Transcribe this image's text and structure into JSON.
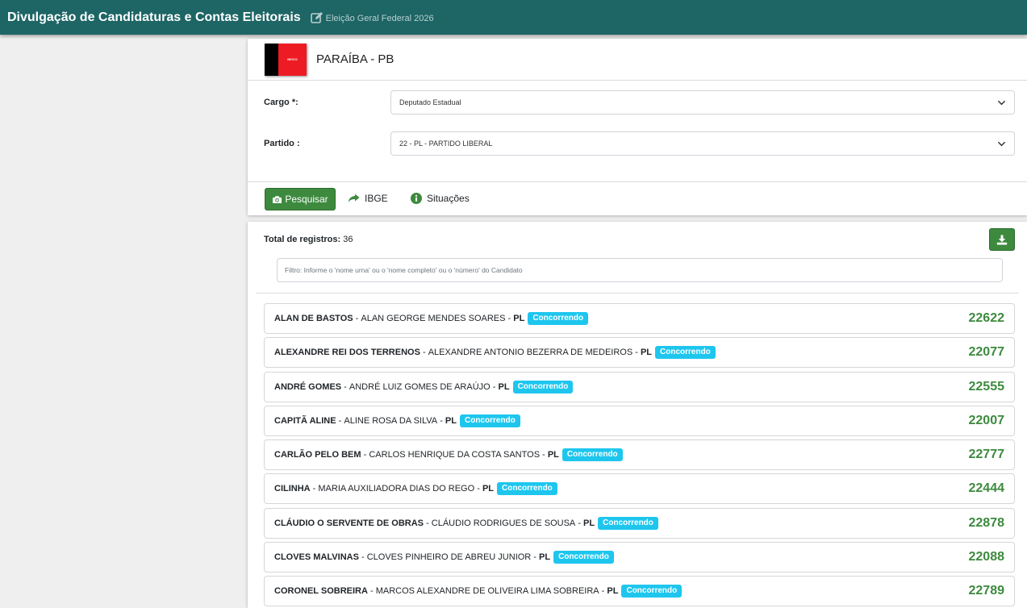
{
  "header": {
    "title": "Divulgação de Candidaturas e Contas Eleitorais",
    "subtitle": "Eleição Geral Federal 2026"
  },
  "uf": {
    "name": "PARAÍBA - PB",
    "flag_text": "NEGO"
  },
  "form": {
    "cargo_label": "Cargo *:",
    "cargo_value": "Deputado Estadual",
    "partido_label": "Partido :",
    "partido_value": "22 - PL - PARTIDO LIBERAL"
  },
  "actions": {
    "search_label": "Pesquisar",
    "ibge_label": "IBGE",
    "situacoes_label": "Situações"
  },
  "results": {
    "total_label": "Total de registros:",
    "total_value": "36",
    "filter_placeholder": "Filtro: Informe o 'nome urna' ou o 'nome completo' ou o 'número' do Candidato",
    "candidates": [
      {
        "urna": "ALAN DE BASTOS",
        "full": "ALAN GEORGE MENDES SOARES",
        "party": "PL",
        "status": "Concorrendo",
        "number": "22622"
      },
      {
        "urna": "ALEXANDRE REI DOS TERRENOS",
        "full": "ALEXANDRE ANTONIO BEZERRA DE MEDEIROS",
        "party": "PL",
        "status": "Concorrendo",
        "number": "22077"
      },
      {
        "urna": "ANDRÉ GOMES",
        "full": "ANDRÉ LUIZ GOMES DE ARAÚJO",
        "party": "PL",
        "status": "Concorrendo",
        "number": "22555"
      },
      {
        "urna": "CAPITÃ ALINE",
        "full": "ALINE ROSA DA SILVA",
        "party": "PL",
        "status": "Concorrendo",
        "number": "22007"
      },
      {
        "urna": "CARLÃO PELO BEM",
        "full": "CARLOS HENRIQUE DA COSTA SANTOS",
        "party": "PL",
        "status": "Concorrendo",
        "number": "22777"
      },
      {
        "urna": "CILINHA",
        "full": "MARIA AUXILIADORA DIAS DO REGO",
        "party": "PL",
        "status": "Concorrendo",
        "number": "22444"
      },
      {
        "urna": "CLÁUDIO O SERVENTE DE OBRAS",
        "full": "CLÁUDIO RODRIGUES DE SOUSA",
        "party": "PL",
        "status": "Concorrendo",
        "number": "22878"
      },
      {
        "urna": "CLOVES MALVINAS",
        "full": "CLOVES PINHEIRO DE ABREU JUNIOR",
        "party": "PL",
        "status": "Concorrendo",
        "number": "22088"
      },
      {
        "urna": "CORONEL SOBREIRA",
        "full": "MARCOS ALEXANDRE DE OLIVEIRA LIMA SOBREIRA",
        "party": "PL",
        "status": "Concorrendo",
        "number": "22789"
      }
    ]
  },
  "icons": {
    "edit": "edit-icon",
    "camera": "camera-icon",
    "share": "share-arrow-icon",
    "info": "info-circle-icon",
    "download": "download-icon",
    "chevron": "chevron-down-icon"
  },
  "colors": {
    "topbar": "#1e6565",
    "accent_green": "#3d8a3e",
    "badge_cyan": "#1ec6ee"
  }
}
